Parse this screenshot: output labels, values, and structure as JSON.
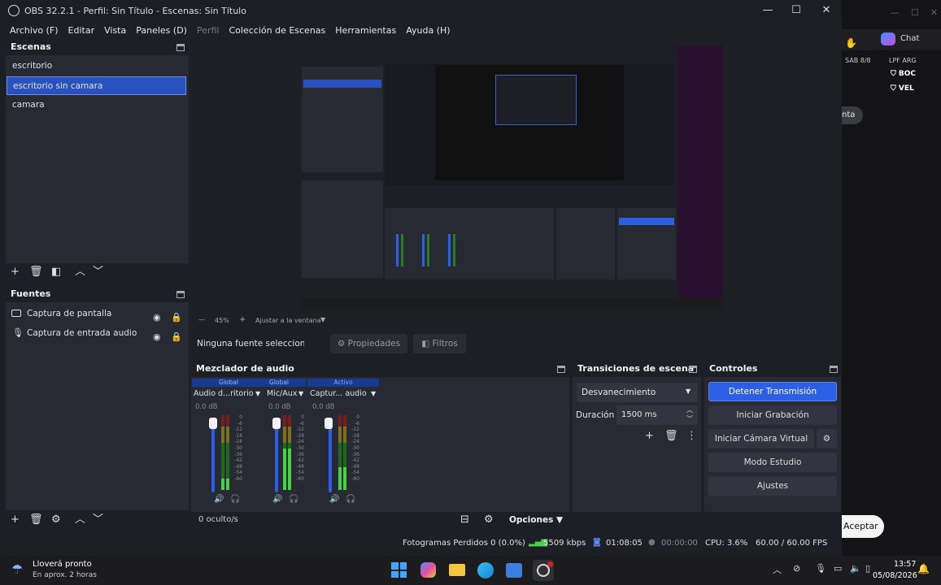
{
  "window": {
    "title": "OBS 32.2.1 - Perfil: Sin Título - Escenas: Sin Título",
    "minimize": "—",
    "maximize": "☐",
    "close": "✕"
  },
  "menu": {
    "items": [
      "Archivo (F)",
      "Editar",
      "Vista",
      "Paneles (D)",
      "Perfil",
      "Colección de Escenas",
      "Herramientas",
      "Ayuda (H)"
    ]
  },
  "scenes": {
    "title": "Escenas",
    "items": [
      "escritorio",
      "escritorio sin camara",
      "camara"
    ],
    "selected": "escritorio sin camara"
  },
  "sources": {
    "title": "Fuentes",
    "items": [
      "Captura de pantalla",
      "Captura de entrada audio"
    ]
  },
  "preview": {
    "zoom": "45%",
    "fit_label": "Ajustar a la ventana"
  },
  "source_bar": {
    "no_source": "Ninguna fuente seleccionad",
    "properties": "Propiedades",
    "filters": "Filtros"
  },
  "mixer": {
    "title": "Mezclador de audio",
    "channels": [
      {
        "badge": "Global",
        "name": "Audio d...ritorio",
        "db": "0.0 dB",
        "level": 0.15
      },
      {
        "badge": "Global",
        "name": "Mic/Aux",
        "db": "0.0 dB",
        "level": 0.55
      },
      {
        "badge": "Activo",
        "name": "Captur... audio",
        "db": "0.0 dB",
        "level": 0.3
      }
    ],
    "scale": [
      "0",
      "-6",
      "-12",
      "-18",
      "-24",
      "-30",
      "-36",
      "-42",
      "-48",
      "-54",
      "-60"
    ],
    "hidden": "0 oculto/s",
    "options": "Opciones"
  },
  "transitions": {
    "title": "Transiciones de escena",
    "selected": "Desvanecimiento",
    "duration_label": "Duración",
    "duration_value": "1500 ms"
  },
  "controls": {
    "title": "Controles",
    "stop_stream": "Detener Transmisión",
    "start_recording": "Iniciar Grabación",
    "virtual_cam": "Iniciar Cámara Virtual",
    "studio_mode": "Modo Estudio",
    "settings": "Ajustes"
  },
  "status": {
    "dropped_frames": "Fotogramas Perdidos 0 (0.0%)",
    "bitrate": "5509 kbps",
    "stream_time": "01:08:05",
    "rec_time": "00:00:00",
    "cpu": "CPU: 3.6%",
    "fps": "60.00 / 60.00 FPS"
  },
  "taskbar": {
    "weather_title": "Lloverá pronto",
    "weather_sub": "En aprox. 2 horas",
    "time": "13:57",
    "date": "05/08/2026"
  },
  "background_app": {
    "chat_label": "Chat",
    "date_label": "SAB 8/8",
    "league_label": "LPF ARG",
    "team1": "BOC",
    "team2": "VEL",
    "pill1": "nta",
    "accept": "Aceptar"
  },
  "colors": {
    "accent": "#2c5ee6",
    "panel_bg": "#272a33",
    "window_bg": "#1e1f26"
  }
}
